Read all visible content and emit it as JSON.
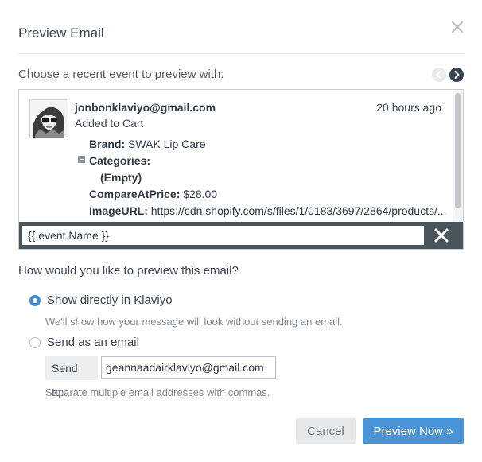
{
  "modal": {
    "title": "Preview Email",
    "choose_label": "Choose a recent event to preview with:"
  },
  "event": {
    "sender": "jonbonklaviyo@gmail.com",
    "type": "Added to Cart",
    "time_ago": "20 hours ago",
    "properties": [
      {
        "key": "Brand:",
        "value": " SWAK Lip Care"
      },
      {
        "key": "Categories:",
        "value": ""
      },
      {
        "key": "(Empty)",
        "value": ""
      },
      {
        "key": "CompareAtPrice:",
        "value": " $28.00"
      },
      {
        "key": "ImageURL:",
        "value": " https://cdn.shopify.com/s/files/1/0183/3697/2864/products/..."
      }
    ]
  },
  "filter": {
    "value": "{{ event.Name }}"
  },
  "preview": {
    "question": "How would you like to preview this email?",
    "option_klaviyo": "Show directly in Klaviyo",
    "option_klaviyo_help": "We'll show how your message will look without sending an email.",
    "option_email": "Send as an email",
    "sendto_label": "Send to:",
    "sendto_value": "geannaadairklaviyo@gmail.com",
    "sendto_help": "Separate multiple email addresses with commas."
  },
  "buttons": {
    "cancel": "Cancel",
    "preview_now": "Preview Now »"
  },
  "colors": {
    "accent": "#4c94d8",
    "radio_checked": "#3f88d8",
    "filter_bar": "#4a545d"
  }
}
